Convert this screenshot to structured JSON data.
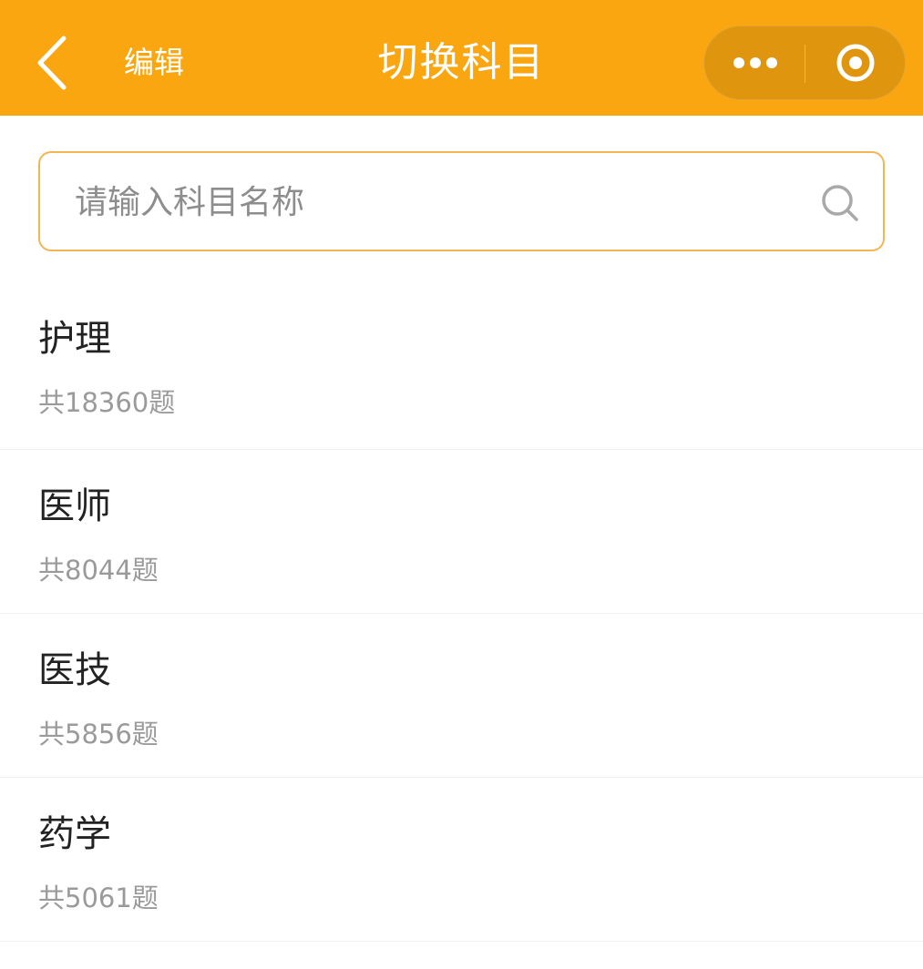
{
  "header": {
    "back_icon": "chevron-left-icon",
    "edit_label": "编辑",
    "title": "切换科目",
    "more_icon": "more-dots-icon",
    "close_icon": "target-circle-icon",
    "background_color": "#f9a610"
  },
  "search": {
    "placeholder": "请输入科目名称",
    "value": "",
    "icon": "search-icon",
    "border_color": "#f3b654"
  },
  "subjects": [
    {
      "name": "护理",
      "count": "共18360题"
    },
    {
      "name": "医师",
      "count": "共8044题"
    },
    {
      "name": "医技",
      "count": "共5856题"
    },
    {
      "name": "药学",
      "count": "共5061题"
    }
  ]
}
